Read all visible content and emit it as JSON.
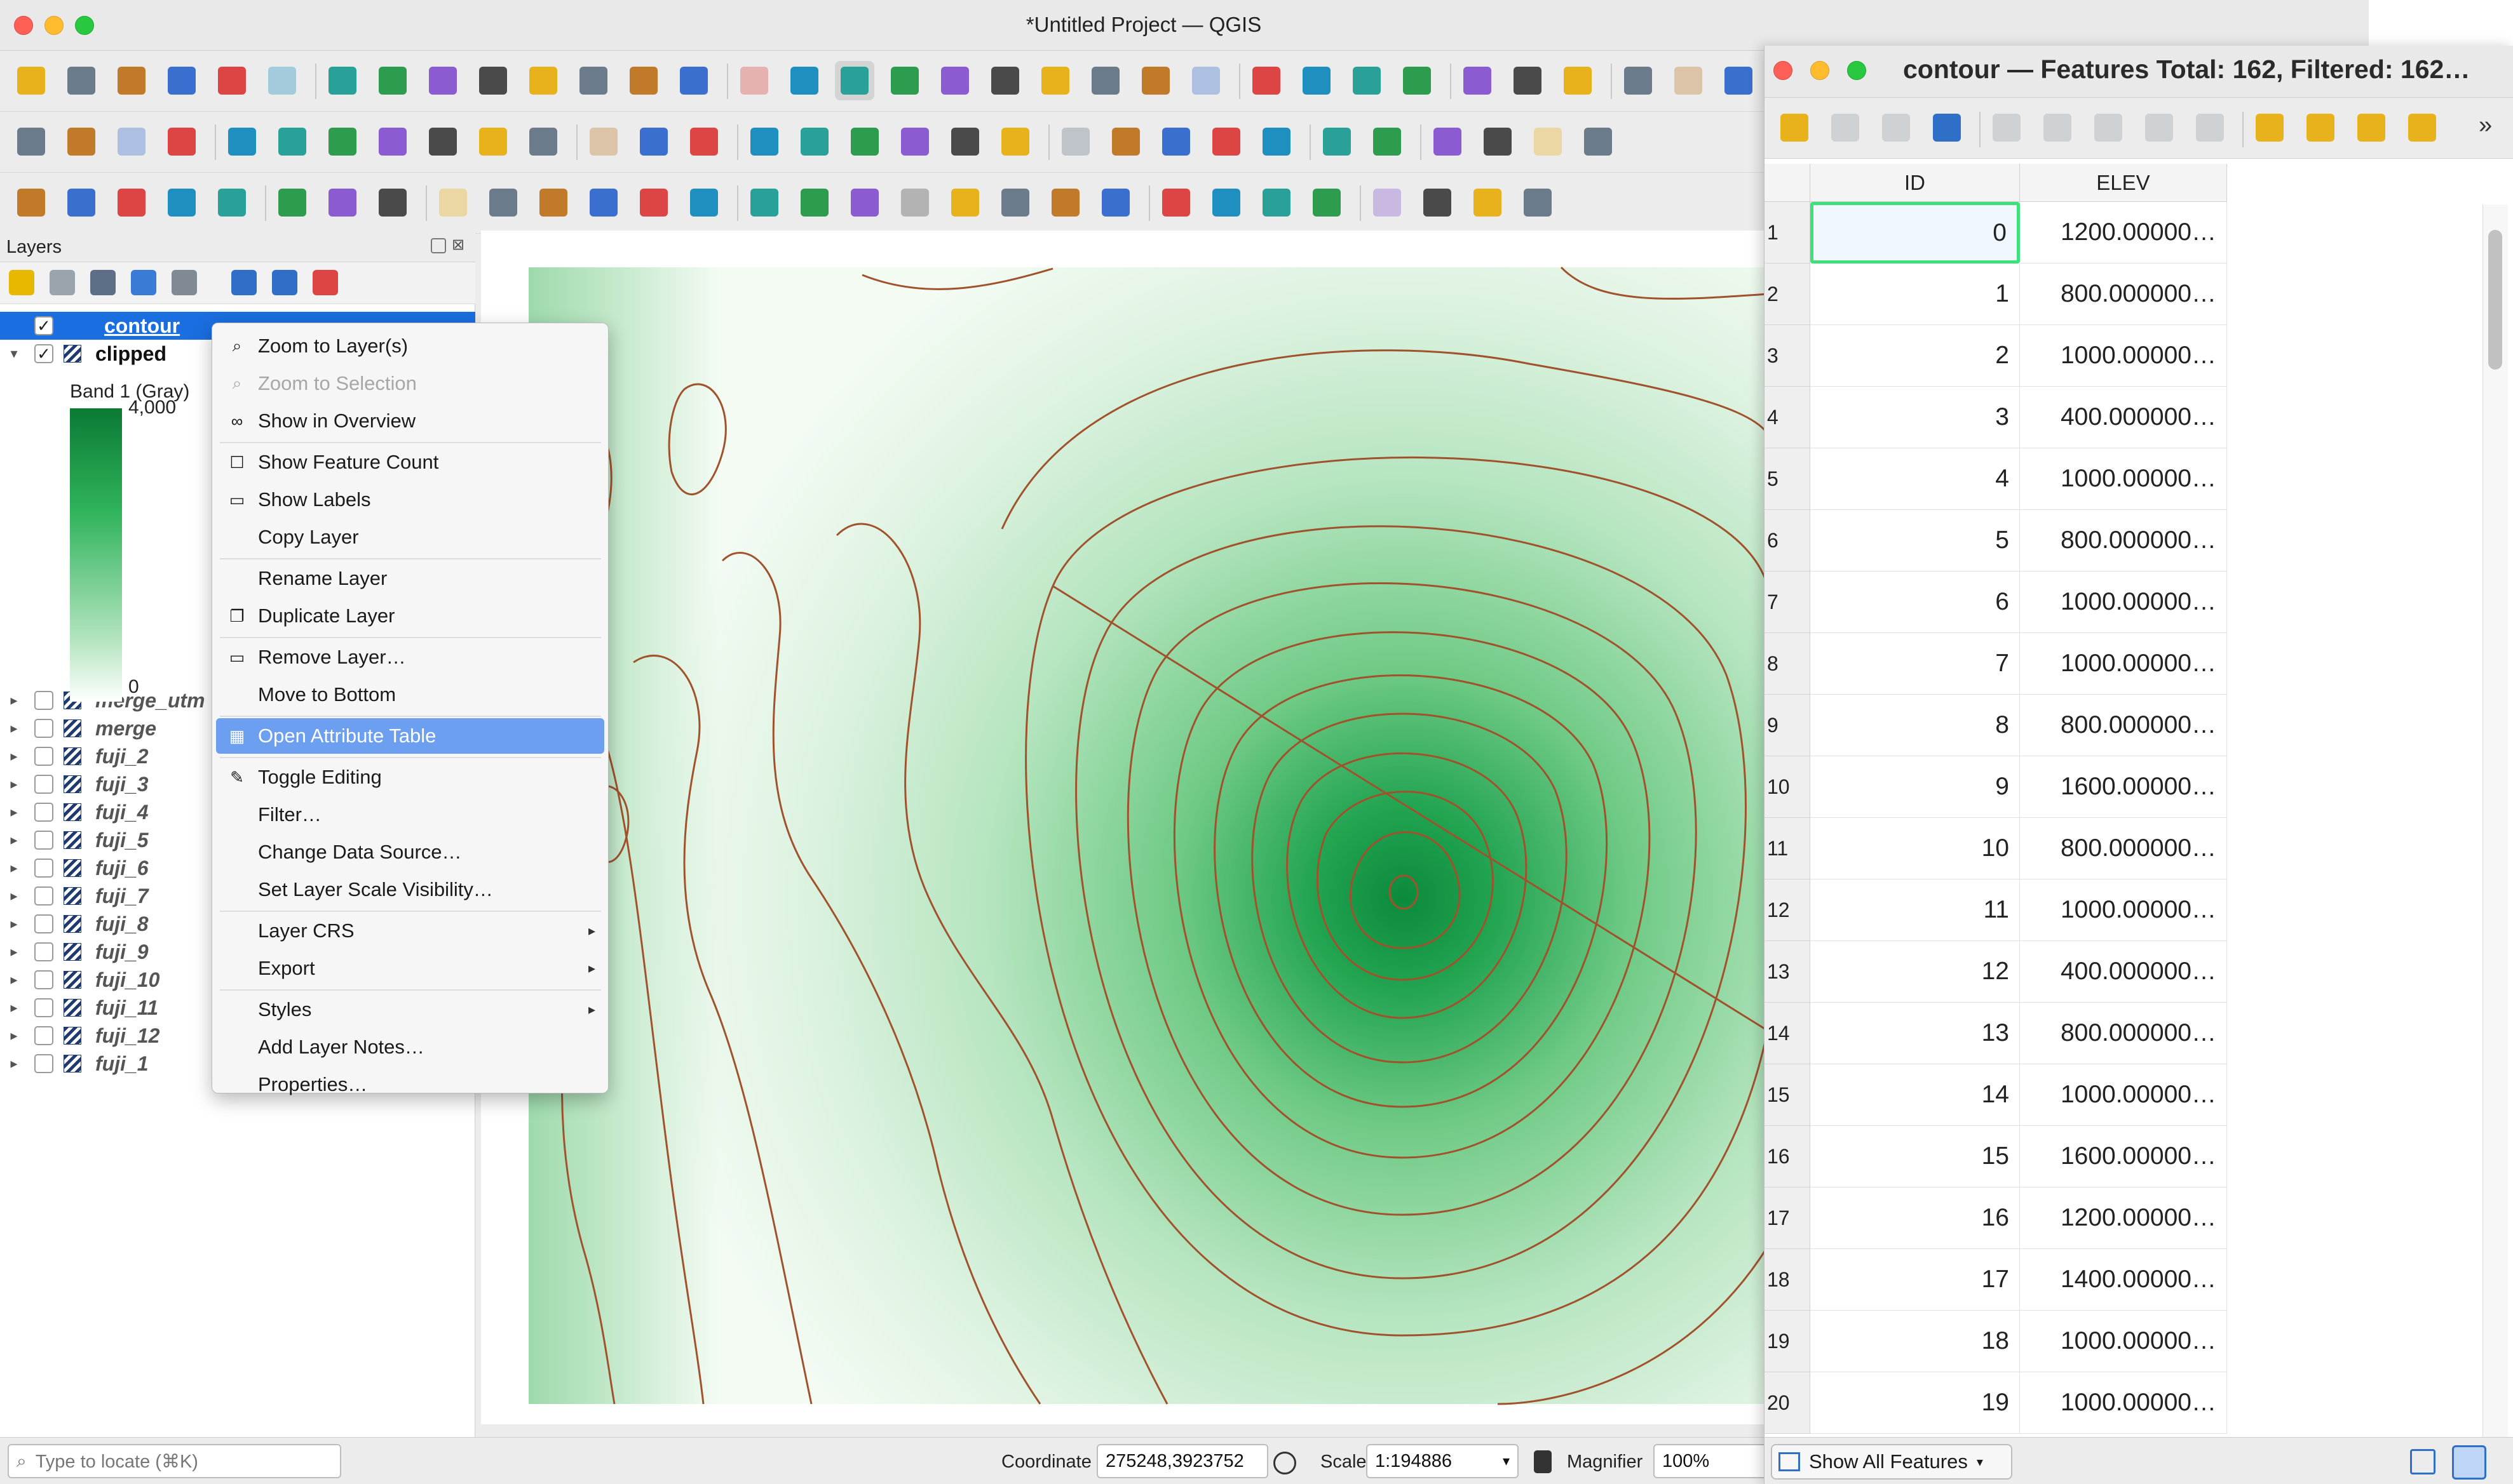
{
  "window": {
    "title": "*Untitled Project — QGIS"
  },
  "layers_panel": {
    "title": "Layers",
    "legend_max": "4,000",
    "legend_min": "0",
    "band_label": "Band 1 (Gray)",
    "layers": [
      {
        "name": "contour",
        "checked": true,
        "active": true
      },
      {
        "name": "clipped",
        "checked": true
      },
      {
        "name": "merge_utm",
        "checked": false
      },
      {
        "name": "merge",
        "checked": false
      },
      {
        "name": "fuji_2",
        "checked": false
      },
      {
        "name": "fuji_3",
        "checked": false
      },
      {
        "name": "fuji_4",
        "checked": false
      },
      {
        "name": "fuji_5",
        "checked": false
      },
      {
        "name": "fuji_6",
        "checked": false
      },
      {
        "name": "fuji_7",
        "checked": false
      },
      {
        "name": "fuji_8",
        "checked": false
      },
      {
        "name": "fuji_9",
        "checked": false
      },
      {
        "name": "fuji_10",
        "checked": false
      },
      {
        "name": "fuji_11",
        "checked": false
      },
      {
        "name": "fuji_12",
        "checked": false
      },
      {
        "name": "fuji_1",
        "checked": false
      }
    ]
  },
  "context_menu": {
    "items": [
      {
        "label": "Zoom to Layer(s)",
        "icon": "zoom-icon"
      },
      {
        "label": "Zoom to Selection",
        "icon": "zoom-icon",
        "disabled": true
      },
      {
        "label": "Show in Overview",
        "icon": "overview-icon"
      },
      {
        "label": "Show Feature Count",
        "icon": "checkbox-icon"
      },
      {
        "label": "Show Labels",
        "icon": "labels-icon"
      },
      {
        "label": "Copy Layer"
      },
      {
        "label": "Rename Layer"
      },
      {
        "label": "Duplicate Layer",
        "icon": "duplicate-icon"
      },
      {
        "label": "Remove Layer…",
        "icon": "remove-icon"
      },
      {
        "label": "Move to Bottom"
      },
      {
        "label": "Open Attribute Table",
        "icon": "table-icon",
        "highlighted": true
      },
      {
        "label": "Toggle Editing",
        "icon": "pencil-icon"
      },
      {
        "label": "Filter…"
      },
      {
        "label": "Change Data Source…"
      },
      {
        "label": "Set Layer Scale Visibility…"
      },
      {
        "label": "Layer CRS",
        "submenu": true
      },
      {
        "label": "Export",
        "submenu": true
      },
      {
        "label": "Styles",
        "submenu": true
      },
      {
        "label": "Add Layer Notes…"
      },
      {
        "label": "Properties…"
      }
    ]
  },
  "statusbar": {
    "locate_placeholder": "Type to locate (⌘K)",
    "coordinate_label": "Coordinate",
    "coordinate_value": "275248,3923752",
    "scale_label": "Scale",
    "scale_value": "1:194886",
    "magnifier_label": "Magnifier",
    "magnifier_value": "100%"
  },
  "attribute_table": {
    "title": "contour — Features Total: 162, Filtered: 162…",
    "columns": [
      "ID",
      "ELEV"
    ],
    "rows": [
      [
        "1",
        "0",
        "1200.00000…"
      ],
      [
        "2",
        "1",
        "800.000000…"
      ],
      [
        "3",
        "2",
        "1000.00000…"
      ],
      [
        "4",
        "3",
        "400.000000…"
      ],
      [
        "5",
        "4",
        "1000.00000…"
      ],
      [
        "6",
        "5",
        "800.000000…"
      ],
      [
        "7",
        "6",
        "1000.00000…"
      ],
      [
        "8",
        "7",
        "1000.00000…"
      ],
      [
        "9",
        "8",
        "800.000000…"
      ],
      [
        "10",
        "9",
        "1600.00000…"
      ],
      [
        "11",
        "10",
        "800.000000…"
      ],
      [
        "12",
        "11",
        "1000.00000…"
      ],
      [
        "13",
        "12",
        "400.000000…"
      ],
      [
        "14",
        "13",
        "800.000000…"
      ],
      [
        "15",
        "14",
        "1000.00000…"
      ],
      [
        "16",
        "15",
        "1600.00000…"
      ],
      [
        "17",
        "16",
        "1200.00000…"
      ],
      [
        "18",
        "17",
        "1400.00000…"
      ],
      [
        "19",
        "18",
        "1000.00000…"
      ],
      [
        "20",
        "19",
        "1000.00000…"
      ]
    ],
    "filter_label": "Show All Features"
  },
  "colors": {
    "accent": "#1b6ee0",
    "menu_highlight": "#6c9ff0",
    "raster_light": "#e8f6e8",
    "raster_dark": "#0b8a3c",
    "contour": "#a0522d"
  }
}
